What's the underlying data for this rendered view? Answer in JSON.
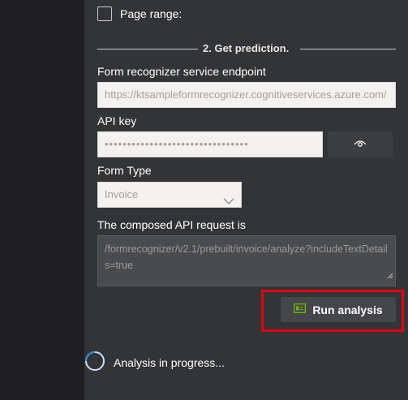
{
  "page_range": {
    "label": "Page range:"
  },
  "section": {
    "title": "2. Get prediction."
  },
  "endpoint": {
    "label": "Form recognizer service endpoint",
    "value": "https://ktsampleformrecognizer.cognitiveservices.azure.com/"
  },
  "api_key": {
    "label": "API key",
    "value": "••••••••••••••••••••••••••••••••",
    "reveal_icon": "eye-icon"
  },
  "form_type": {
    "label": "Form Type",
    "selected": "Invoice"
  },
  "request": {
    "label": "The composed API request is",
    "value": "/formrecognizer/v2.1/prebuilt/invoice/analyze?includeTextDetails=true"
  },
  "run": {
    "label": "Run analysis",
    "icon": "table-icon",
    "icon_color": "#6bb700",
    "highlight_color": "#e3000f"
  },
  "status": {
    "text": "Analysis in progress...",
    "spinner_color": "#2b88d8"
  }
}
